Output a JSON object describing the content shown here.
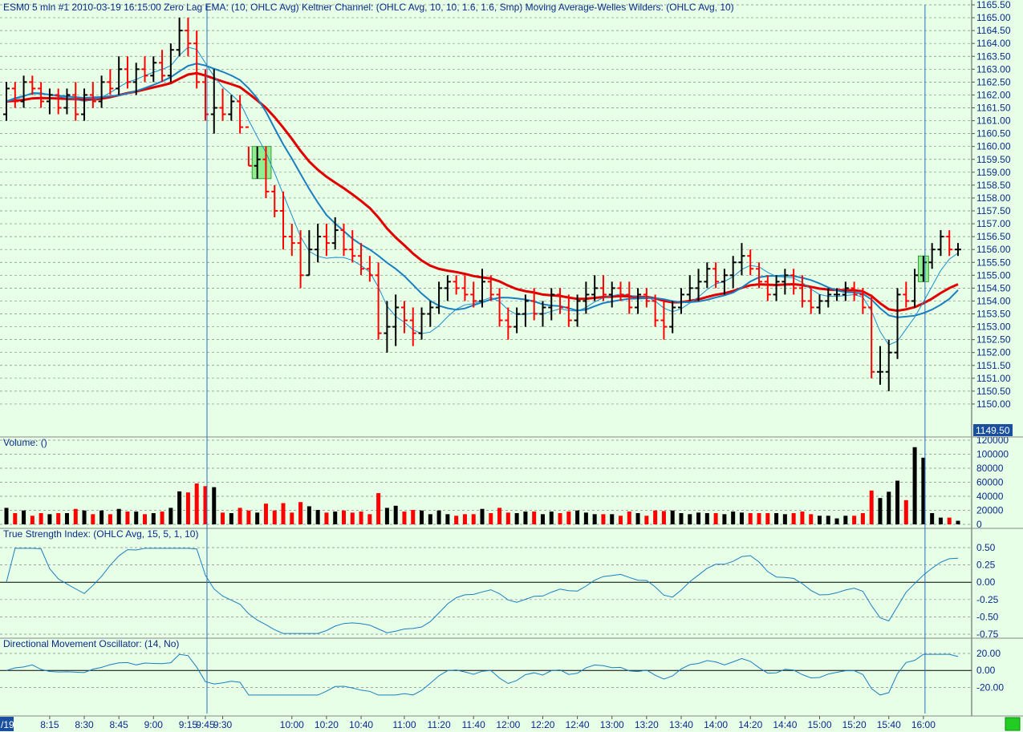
{
  "header": {
    "price": "ESM0  5 min   #1  2010-03-19  16:15:00  Zero Lag EMA:   (10, OHLC Avg)    Keltner Channel:   (OHLC Avg, 10, 10, 1.6, 1.6, Smp)    Moving Average-Welles Wilders:    (OHLC Avg, 10)",
    "volume": "Volume:   ()",
    "tsi": "True Strength Index:    (OHLC Avg, 15, 5, 1, 10)",
    "dmo": "Directional Movement Oscillator:   (14, No)"
  },
  "last_price_label": "1149.50",
  "date_marker": "/19",
  "colors": {
    "background": "#e6ffe6",
    "up_bar": "#000000",
    "down_bar": "#ff0000",
    "zero_lag_ema": "#1a8fd0",
    "keltner_mid": "#1a7fc0",
    "wilders": "#e00000",
    "text": "#0a2a8a",
    "grid": "#888888"
  },
  "chart_data": [
    {
      "type": "ohlc",
      "name": "price",
      "ylim": [
        1149.5,
        1165.5
      ],
      "yticks": [
        "1150.00",
        "1150.50",
        "1151.00",
        "1151.50",
        "1152.00",
        "1152.50",
        "1153.00",
        "1153.50",
        "1154.00",
        "1154.50",
        "1155.00",
        "1155.50",
        "1156.00",
        "1156.50",
        "1157.00",
        "1157.50",
        "1158.00",
        "1158.50",
        "1159.00",
        "1159.50",
        "1160.00",
        "1160.50",
        "1161.00",
        "1161.50",
        "1162.00",
        "1162.50",
        "1163.00",
        "1163.50",
        "1164.00",
        "1164.50",
        "1165.00",
        "1165.50"
      ],
      "xticks": [
        "8:15",
        "8:30",
        "8:45",
        "9:00",
        "9:15",
        "9:30",
        "9:45",
        "10:00",
        "10:20",
        "10:40",
        "11:00",
        "11:20",
        "11:40",
        "12:00",
        "12:20",
        "12:40",
        "13:00",
        "13:20",
        "13:40",
        "14:00",
        "14:20",
        "14:40",
        "15:00",
        "15:20",
        "15:40",
        "16:00"
      ],
      "bars": [
        [
          1161.25,
          1162.5,
          1161.0,
          1162.25
        ],
        [
          1162.25,
          1162.5,
          1161.5,
          1161.75
        ],
        [
          1161.75,
          1162.75,
          1161.5,
          1162.5
        ],
        [
          1162.5,
          1162.75,
          1162.0,
          1162.25
        ],
        [
          1162.25,
          1162.5,
          1161.5,
          1161.75
        ],
        [
          1161.75,
          1162.25,
          1161.25,
          1162.0
        ],
        [
          1162.0,
          1162.25,
          1161.25,
          1161.5
        ],
        [
          1161.5,
          1162.25,
          1161.25,
          1162.0
        ],
        [
          1162.0,
          1162.5,
          1161.0,
          1161.25
        ],
        [
          1161.25,
          1162.25,
          1161.0,
          1162.0
        ],
        [
          1162.0,
          1162.5,
          1161.5,
          1161.75
        ],
        [
          1161.75,
          1162.75,
          1161.5,
          1162.5
        ],
        [
          1162.5,
          1163.0,
          1162.0,
          1162.25
        ],
        [
          1162.25,
          1163.5,
          1162.0,
          1163.0
        ],
        [
          1163.0,
          1163.5,
          1162.25,
          1162.5
        ],
        [
          1162.5,
          1163.25,
          1162.0,
          1163.0
        ],
        [
          1163.0,
          1163.5,
          1162.5,
          1162.75
        ],
        [
          1162.75,
          1163.5,
          1162.5,
          1163.25
        ],
        [
          1163.25,
          1163.75,
          1162.5,
          1162.75
        ],
        [
          1162.75,
          1164.0,
          1162.5,
          1163.75
        ],
        [
          1163.75,
          1165.0,
          1163.5,
          1164.5
        ],
        [
          1164.5,
          1165.0,
          1163.5,
          1164.0
        ],
        [
          1164.0,
          1164.5,
          1162.25,
          1162.5
        ],
        [
          1162.5,
          1163.0,
          1161.0,
          1161.25
        ],
        [
          1161.25,
          1163.0,
          1160.5,
          1161.5
        ],
        [
          1161.5,
          1162.25,
          1161.0,
          1161.25
        ],
        [
          1161.25,
          1162.0,
          1161.0,
          1161.75
        ],
        [
          1161.75,
          1162.0,
          1160.5,
          1160.75
        ],
        [
          1160.75,
          1160.0,
          1159.25,
          1159.25
        ],
        [
          1159.25,
          1160.0,
          1158.75,
          1159.5
        ],
        [
          1159.5,
          1160.0,
          1158.0,
          1158.25
        ],
        [
          1158.25,
          1158.5,
          1157.25,
          1157.5
        ],
        [
          1157.5,
          1158.25,
          1156.0,
          1156.5
        ],
        [
          1156.5,
          1157.0,
          1155.75,
          1156.25
        ],
        [
          1156.25,
          1156.75,
          1154.5,
          1155.0
        ],
        [
          1155.0,
          1156.75,
          1155.0,
          1156.0
        ],
        [
          1156.0,
          1157.0,
          1155.5,
          1156.5
        ],
        [
          1156.5,
          1157.0,
          1155.75,
          1156.25
        ],
        [
          1156.25,
          1157.25,
          1156.0,
          1156.75
        ],
        [
          1156.75,
          1157.0,
          1155.75,
          1156.0
        ],
        [
          1156.0,
          1156.75,
          1155.5,
          1155.75
        ],
        [
          1155.75,
          1156.25,
          1155.0,
          1155.25
        ],
        [
          1155.25,
          1155.75,
          1154.75,
          1155.0
        ],
        [
          1155.0,
          1155.5,
          1152.5,
          1152.75
        ],
        [
          1152.75,
          1154.0,
          1152.0,
          1153.0
        ],
        [
          1153.0,
          1154.25,
          1152.25,
          1153.75
        ],
        [
          1153.75,
          1154.0,
          1152.75,
          1153.25
        ],
        [
          1153.25,
          1153.75,
          1152.25,
          1152.75
        ],
        [
          1152.75,
          1153.75,
          1152.5,
          1153.5
        ],
        [
          1153.5,
          1154.0,
          1153.0,
          1153.75
        ],
        [
          1153.75,
          1154.75,
          1153.5,
          1154.5
        ],
        [
          1154.5,
          1155.0,
          1154.0,
          1154.75
        ],
        [
          1154.75,
          1155.0,
          1154.25,
          1154.5
        ],
        [
          1154.5,
          1155.0,
          1154.0,
          1154.25
        ],
        [
          1154.25,
          1154.75,
          1153.75,
          1154.0
        ],
        [
          1154.0,
          1155.25,
          1153.75,
          1154.75
        ],
        [
          1154.75,
          1155.0,
          1154.0,
          1154.25
        ],
        [
          1154.25,
          1154.5,
          1153.0,
          1153.25
        ],
        [
          1153.25,
          1153.75,
          1152.5,
          1153.0
        ],
        [
          1153.0,
          1153.75,
          1152.75,
          1153.5
        ],
        [
          1153.5,
          1154.25,
          1153.0,
          1154.0
        ],
        [
          1154.0,
          1154.5,
          1153.25,
          1153.5
        ],
        [
          1153.5,
          1154.0,
          1153.0,
          1153.75
        ],
        [
          1153.75,
          1154.5,
          1153.25,
          1154.25
        ],
        [
          1154.25,
          1154.5,
          1153.5,
          1153.75
        ],
        [
          1153.75,
          1154.25,
          1153.0,
          1153.25
        ],
        [
          1153.25,
          1154.25,
          1153.0,
          1154.0
        ],
        [
          1154.0,
          1154.75,
          1153.5,
          1154.25
        ],
        [
          1154.25,
          1155.0,
          1154.0,
          1154.5
        ],
        [
          1154.5,
          1155.0,
          1154.0,
          1154.25
        ],
        [
          1154.25,
          1154.75,
          1153.75,
          1154.5
        ],
        [
          1154.5,
          1154.75,
          1154.0,
          1154.25
        ],
        [
          1154.25,
          1154.75,
          1153.5,
          1153.75
        ],
        [
          1153.75,
          1154.5,
          1153.5,
          1154.25
        ],
        [
          1154.25,
          1154.5,
          1153.75,
          1154.0
        ],
        [
          1154.0,
          1154.25,
          1153.0,
          1153.25
        ],
        [
          1153.25,
          1154.0,
          1152.5,
          1153.0
        ],
        [
          1153.0,
          1154.0,
          1152.75,
          1153.75
        ],
        [
          1153.75,
          1154.5,
          1153.5,
          1154.25
        ],
        [
          1154.25,
          1155.0,
          1154.0,
          1154.5
        ],
        [
          1154.5,
          1155.25,
          1154.0,
          1154.75
        ],
        [
          1154.75,
          1155.5,
          1154.5,
          1155.25
        ],
        [
          1155.25,
          1155.5,
          1154.5,
          1154.75
        ],
        [
          1154.75,
          1155.25,
          1154.25,
          1155.0
        ],
        [
          1155.0,
          1155.75,
          1154.5,
          1155.5
        ],
        [
          1155.5,
          1156.25,
          1155.0,
          1155.75
        ],
        [
          1155.75,
          1156.0,
          1155.0,
          1155.25
        ],
        [
          1155.25,
          1155.5,
          1154.5,
          1154.75
        ],
        [
          1154.75,
          1155.0,
          1154.0,
          1154.25
        ],
        [
          1154.25,
          1155.0,
          1154.0,
          1154.75
        ],
        [
          1154.75,
          1155.25,
          1154.25,
          1155.0
        ],
        [
          1155.0,
          1155.25,
          1154.25,
          1154.5
        ],
        [
          1154.5,
          1155.0,
          1153.75,
          1154.0
        ],
        [
          1154.0,
          1154.5,
          1153.5,
          1153.75
        ],
        [
          1153.75,
          1154.25,
          1153.5,
          1154.0
        ],
        [
          1154.0,
          1154.5,
          1153.75,
          1154.25
        ],
        [
          1154.25,
          1154.5,
          1154.0,
          1154.25
        ],
        [
          1154.25,
          1154.75,
          1154.0,
          1154.5
        ],
        [
          1154.5,
          1154.75,
          1154.0,
          1154.25
        ],
        [
          1154.25,
          1154.5,
          1153.5,
          1153.75
        ],
        [
          1153.75,
          1154.25,
          1151.0,
          1151.25
        ],
        [
          1151.25,
          1152.25,
          1150.75,
          1151.25
        ],
        [
          1151.25,
          1152.5,
          1150.5,
          1152.0
        ],
        [
          1152.0,
          1154.5,
          1151.75,
          1154.25
        ],
        [
          1154.25,
          1154.75,
          1153.75,
          1154.0
        ],
        [
          1154.0,
          1155.25,
          1153.75,
          1155.0
        ],
        [
          1155.0,
          1155.75,
          1154.75,
          1155.5
        ],
        [
          1155.5,
          1156.25,
          1155.25,
          1156.0
        ],
        [
          1156.0,
          1156.75,
          1155.75,
          1156.5
        ],
        [
          1156.5,
          1156.75,
          1155.75,
          1156.0
        ],
        [
          1156.0,
          1156.25,
          1155.75,
          1156.0
        ]
      ],
      "highlight_boxes": [
        {
          "bar_from": 29,
          "bar_to": 30,
          "low": 1158.75,
          "high": 1160.0
        },
        {
          "bar_from": 106,
          "bar_to": 106,
          "low": 1154.75,
          "high": 1155.75
        }
      ],
      "session_lines_at": [
        "9:45",
        "16:00"
      ]
    },
    {
      "type": "bar",
      "name": "volume",
      "ylim": [
        0,
        120000
      ],
      "yticks": [
        "0",
        "20000",
        "40000",
        "60000",
        "80000",
        "100000",
        "120000"
      ]
    },
    {
      "type": "line",
      "name": "tsi",
      "ylim": [
        -0.75,
        0.5
      ],
      "yticks": [
        "0.50",
        "0.25",
        "0.00",
        "-0.25",
        "-0.50",
        "-0.75"
      ]
    },
    {
      "type": "line",
      "name": "dmo",
      "ylim": [
        -30,
        20
      ],
      "yticks": [
        "20.00",
        "0.00",
        "-20.00"
      ]
    }
  ]
}
